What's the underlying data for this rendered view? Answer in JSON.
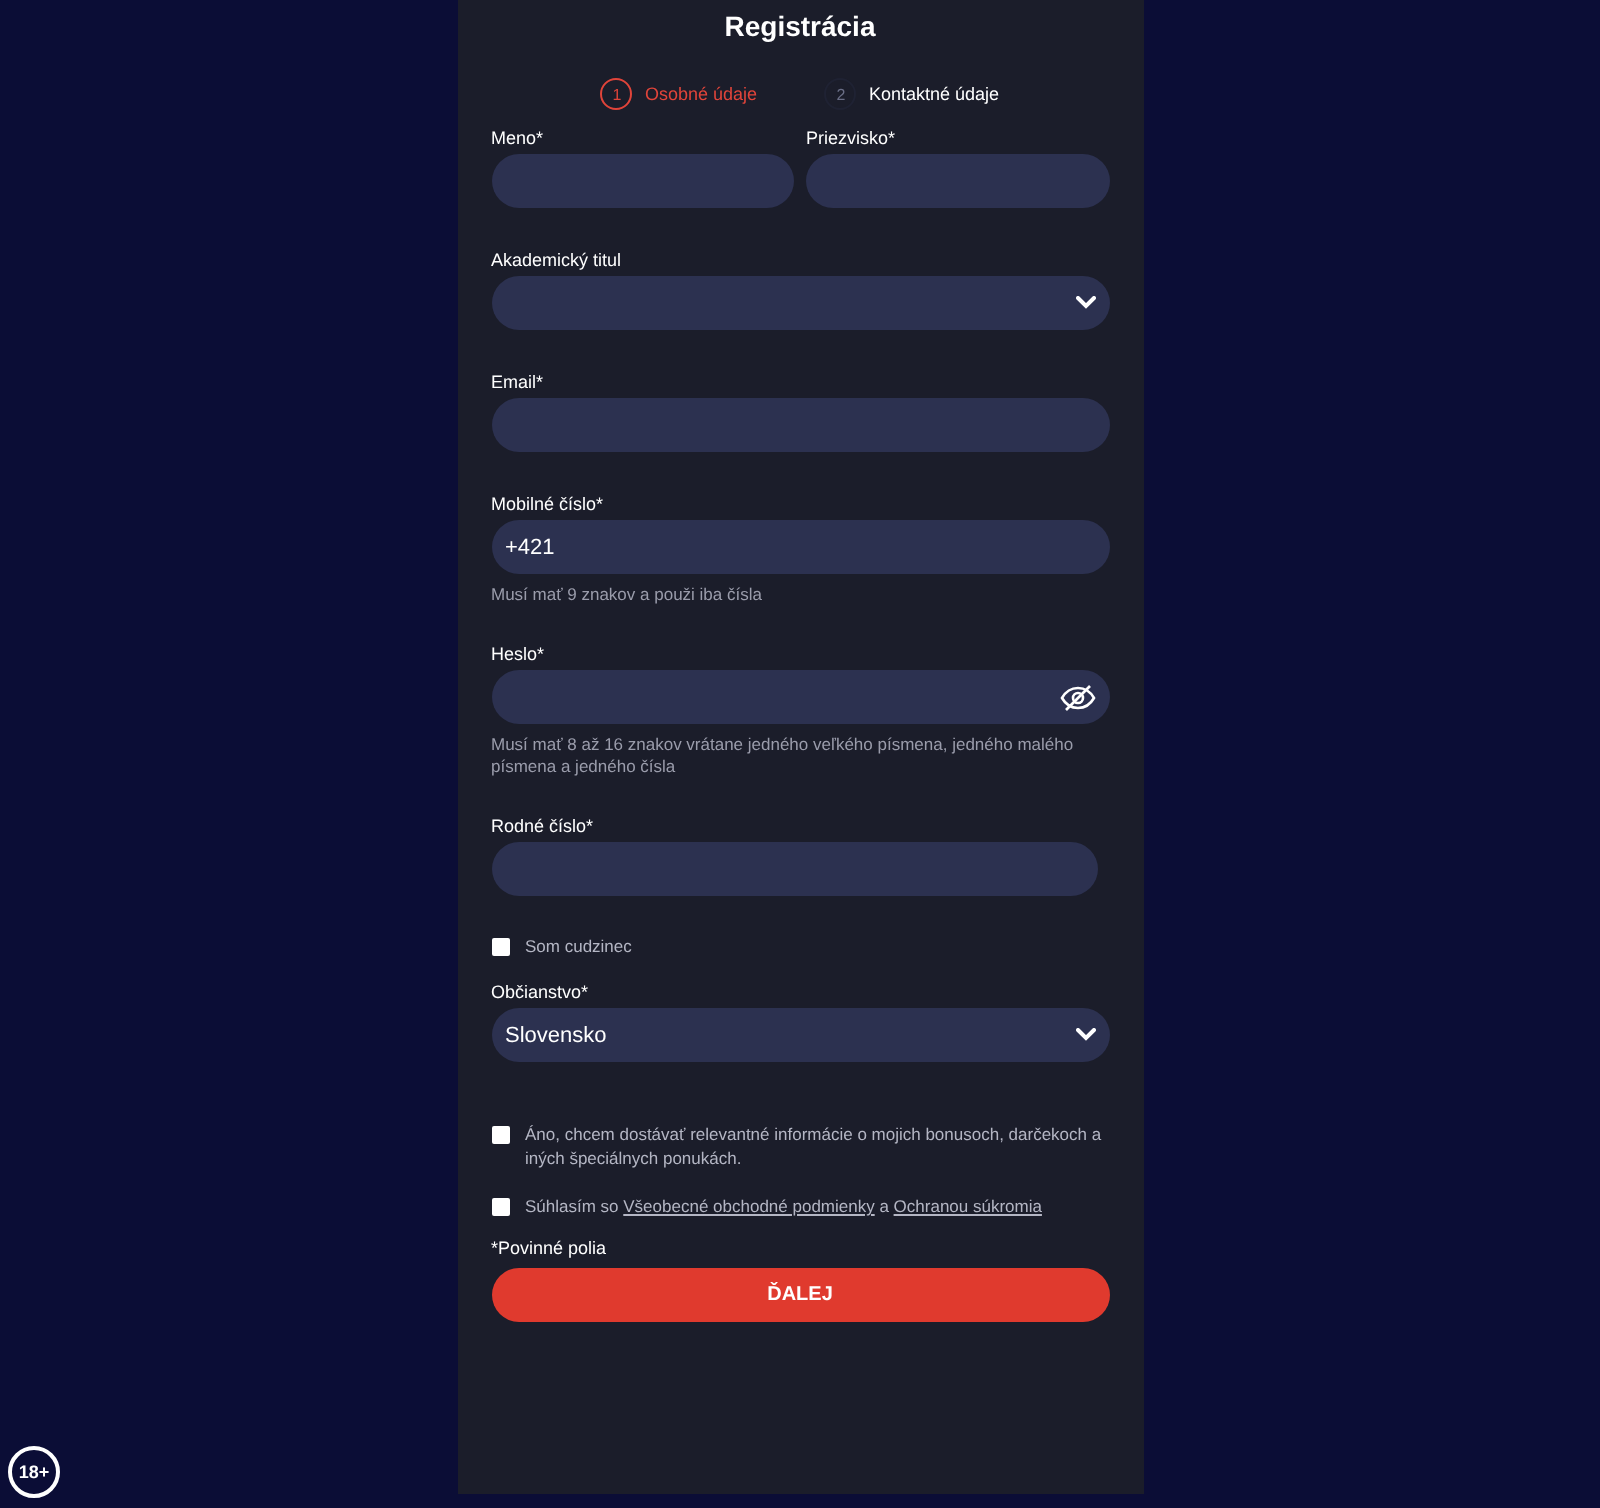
{
  "title": "Registrácia",
  "steps": [
    {
      "number": "1",
      "label": "Osobné údaje",
      "selected": true
    },
    {
      "number": "2",
      "label": "Kontaktné údaje",
      "selected": false
    }
  ],
  "name_fields": [
    {
      "label": "Meno*"
    },
    {
      "label": "Priezvisko*"
    }
  ],
  "fields": [
    {
      "kind": "select",
      "label": "Akademický titul"
    },
    {
      "kind": "text",
      "label": "Email*"
    },
    {
      "kind": "text",
      "label": "Mobilné číslo*",
      "value": "+421",
      "hint": "Musí mať 9 znakov a použi iba čísla"
    },
    {
      "kind": "password",
      "label": "Heslo*",
      "hint": "Musí mať 8 až 16 znakov vrátane jedného veľkého písmena, jedného malého písmena a jedného čísla"
    },
    {
      "kind": "narrow",
      "label": "Rodné číslo*"
    }
  ],
  "foreigner": {
    "label": "Som cudzinec",
    "checked": false
  },
  "citizenship": {
    "label": "Občianstvo*",
    "value": "Slovensko"
  },
  "consents": [
    {
      "checked": false,
      "parts": [
        {
          "kind": "text",
          "text": "Áno, chcem dostávať relevantné informácie o mojich bonusoch, darčekoch a iných špeciálnych ponukách."
        }
      ]
    },
    {
      "checked": false,
      "parts": [
        {
          "kind": "text",
          "text": "Súhlasím so "
        },
        {
          "kind": "link",
          "text": "Všeobecné obchodné podmienky"
        },
        {
          "kind": "text",
          "text": " a "
        },
        {
          "kind": "link",
          "text": "Ochranou súkromia"
        }
      ]
    }
  ],
  "required_note": "*Povinné polia",
  "submit": "ĎALEJ",
  "age_badge": "18+"
}
